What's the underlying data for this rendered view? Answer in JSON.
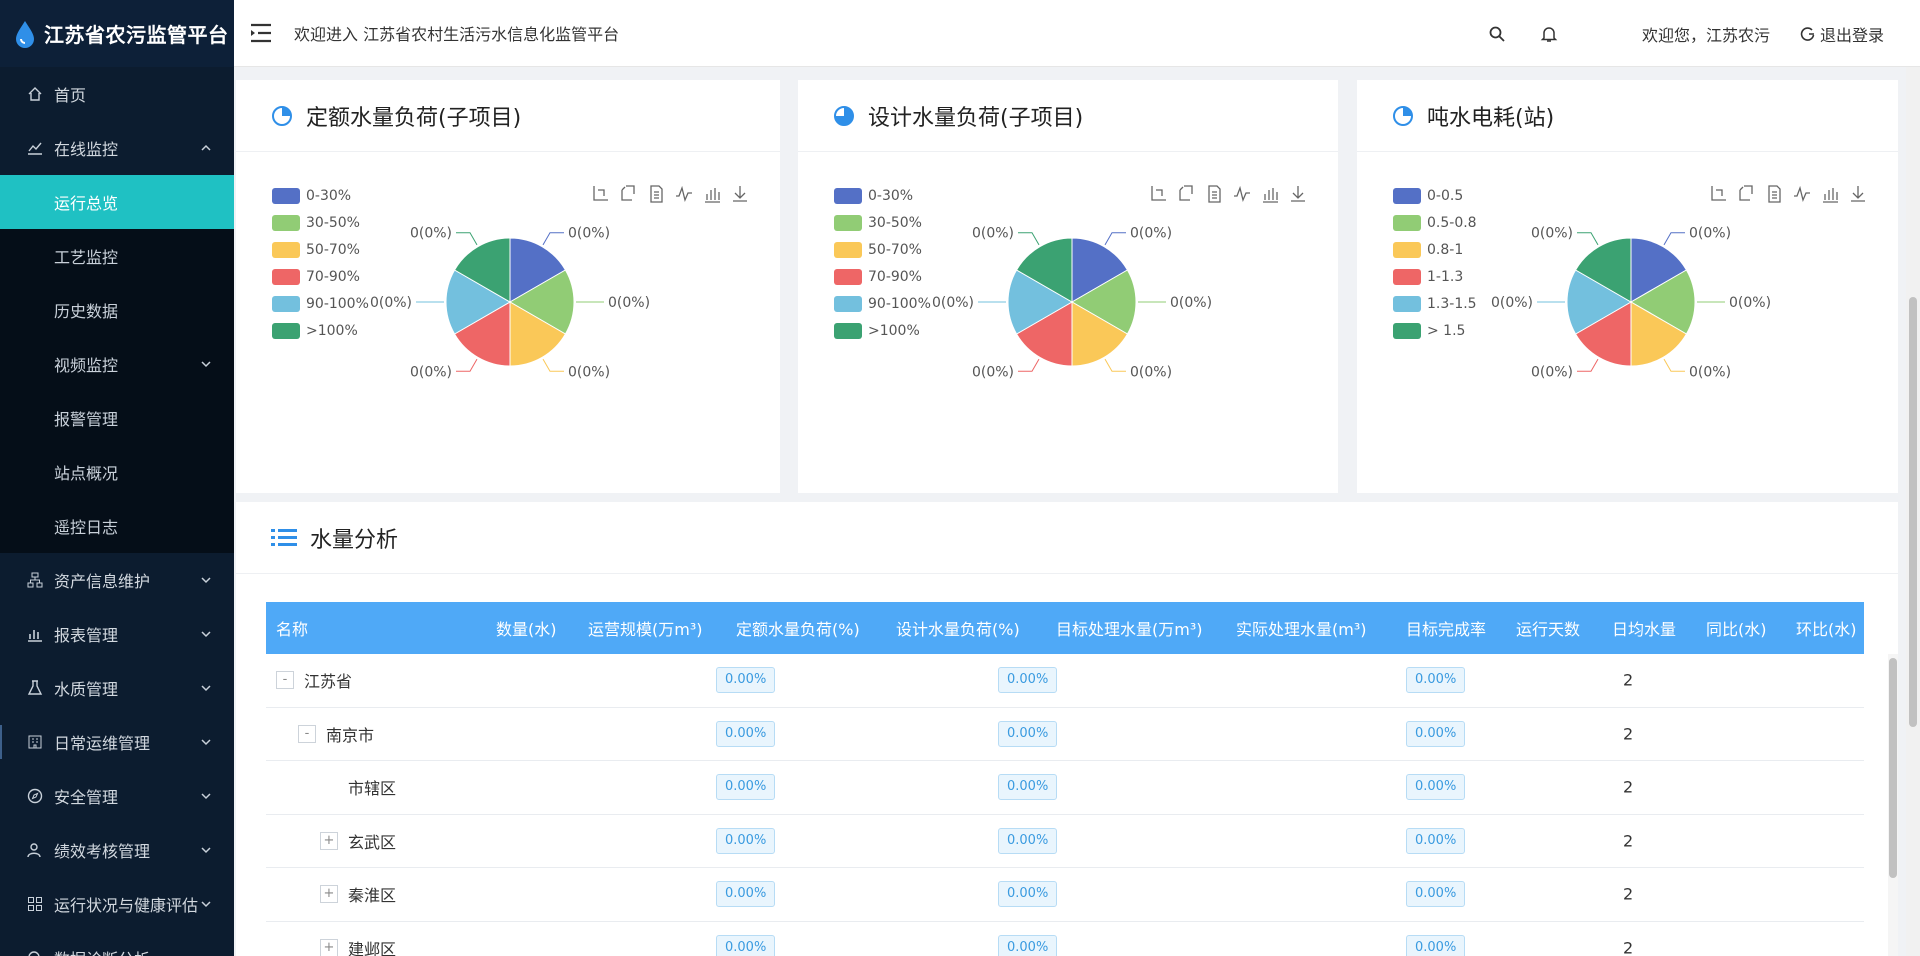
{
  "app": {
    "title": "江苏省农污监管平台"
  },
  "header": {
    "welcome": "欢迎进入 江苏省农村生活污水信息化监管平台",
    "user": "欢迎您，江苏农污",
    "logout": "退出登录"
  },
  "sidebar": {
    "home": "首页",
    "online": "在线监控",
    "sub": [
      "运行总览",
      "工艺监控",
      "历史数据",
      "视频监控",
      "报警管理",
      "站点概况",
      "遥控日志"
    ],
    "items": [
      "资产信息维护",
      "报表管理",
      "水质管理",
      "日常运维管理",
      "安全管理",
      "绩效考核管理",
      "运行状况与健康评估",
      "数据诊断分析"
    ]
  },
  "colors": [
    "#5470c6",
    "#91cc75",
    "#fac858",
    "#ee6666",
    "#73c0de",
    "#3ba272"
  ],
  "charts": [
    {
      "title": "定额水量负荷(子项目)",
      "legend": [
        "0-30%",
        "30-50%",
        "50-70%",
        "70-90%",
        "90-100%",
        ">100%"
      ]
    },
    {
      "title": "设计水量负荷(子项目)",
      "legend": [
        "0-30%",
        "30-50%",
        "50-70%",
        "70-90%",
        "90-100%",
        ">100%"
      ]
    },
    {
      "title": "吨水电耗(站)",
      "legend": [
        "0-0.5",
        "0.5-0.8",
        "0.8-1",
        "1-1.3",
        "1.3-1.5",
        "> 1.5"
      ]
    }
  ],
  "chart_data": [
    {
      "type": "pie",
      "title": "定额水量负荷(子项目)",
      "categories": [
        "0-30%",
        "30-50%",
        "50-70%",
        "70-90%",
        "90-100%",
        ">100%"
      ],
      "values": [
        0,
        0,
        0,
        0,
        0,
        0
      ],
      "labels": [
        "0(0%)",
        "0(0%)",
        "0(0%)",
        "0(0%)",
        "0(0%)",
        "0(0%)"
      ]
    },
    {
      "type": "pie",
      "title": "设计水量负荷(子项目)",
      "categories": [
        "0-30%",
        "30-50%",
        "50-70%",
        "70-90%",
        "90-100%",
        ">100%"
      ],
      "values": [
        0,
        0,
        0,
        0,
        0,
        0
      ],
      "labels": [
        "0(0%)",
        "0(0%)",
        "0(0%)",
        "0(0%)",
        "0(0%)",
        "0(0%)"
      ]
    },
    {
      "type": "pie",
      "title": "吨水电耗(站)",
      "categories": [
        "0-0.5",
        "0.5-0.8",
        "0.8-1",
        "1-1.3",
        "1.3-1.5",
        "> 1.5"
      ],
      "values": [
        0,
        0,
        0,
        0,
        0,
        0
      ],
      "labels": [
        "0(0%)",
        "0(0%)",
        "0(0%)",
        "0(0%)",
        "0(0%)",
        "0(0%)"
      ]
    }
  ],
  "table": {
    "title": "水量分析",
    "columns": [
      "名称",
      "数量(水)",
      "运营规模(万m³)",
      "定额水量负荷(%)",
      "设计水量负荷(%)",
      "目标处理水量(万m³)",
      "实际处理水量(m³)",
      "目标完成率",
      "运行天数",
      "日均水量",
      "同比(水)",
      "环比(水)"
    ],
    "rows": [
      {
        "name": "江苏省",
        "expander": "-",
        "quota": "0.00%",
        "design": "0.00%",
        "rate": "0.00%",
        "daily": "2"
      },
      {
        "name": "南京市",
        "expander": "-",
        "quota": "0.00%",
        "design": "0.00%",
        "rate": "0.00%",
        "daily": "2"
      },
      {
        "name": "市辖区",
        "expander": "",
        "quota": "0.00%",
        "design": "0.00%",
        "rate": "0.00%",
        "daily": "2"
      },
      {
        "name": "玄武区",
        "expander": "+",
        "quota": "0.00%",
        "design": "0.00%",
        "rate": "0.00%",
        "daily": "2"
      },
      {
        "name": "秦淮区",
        "expander": "+",
        "quota": "0.00%",
        "design": "0.00%",
        "rate": "0.00%",
        "daily": "2"
      },
      {
        "name": "建邺区",
        "expander": "+",
        "quota": "0.00%",
        "design": "0.00%",
        "rate": "0.00%",
        "daily": "2"
      }
    ]
  }
}
